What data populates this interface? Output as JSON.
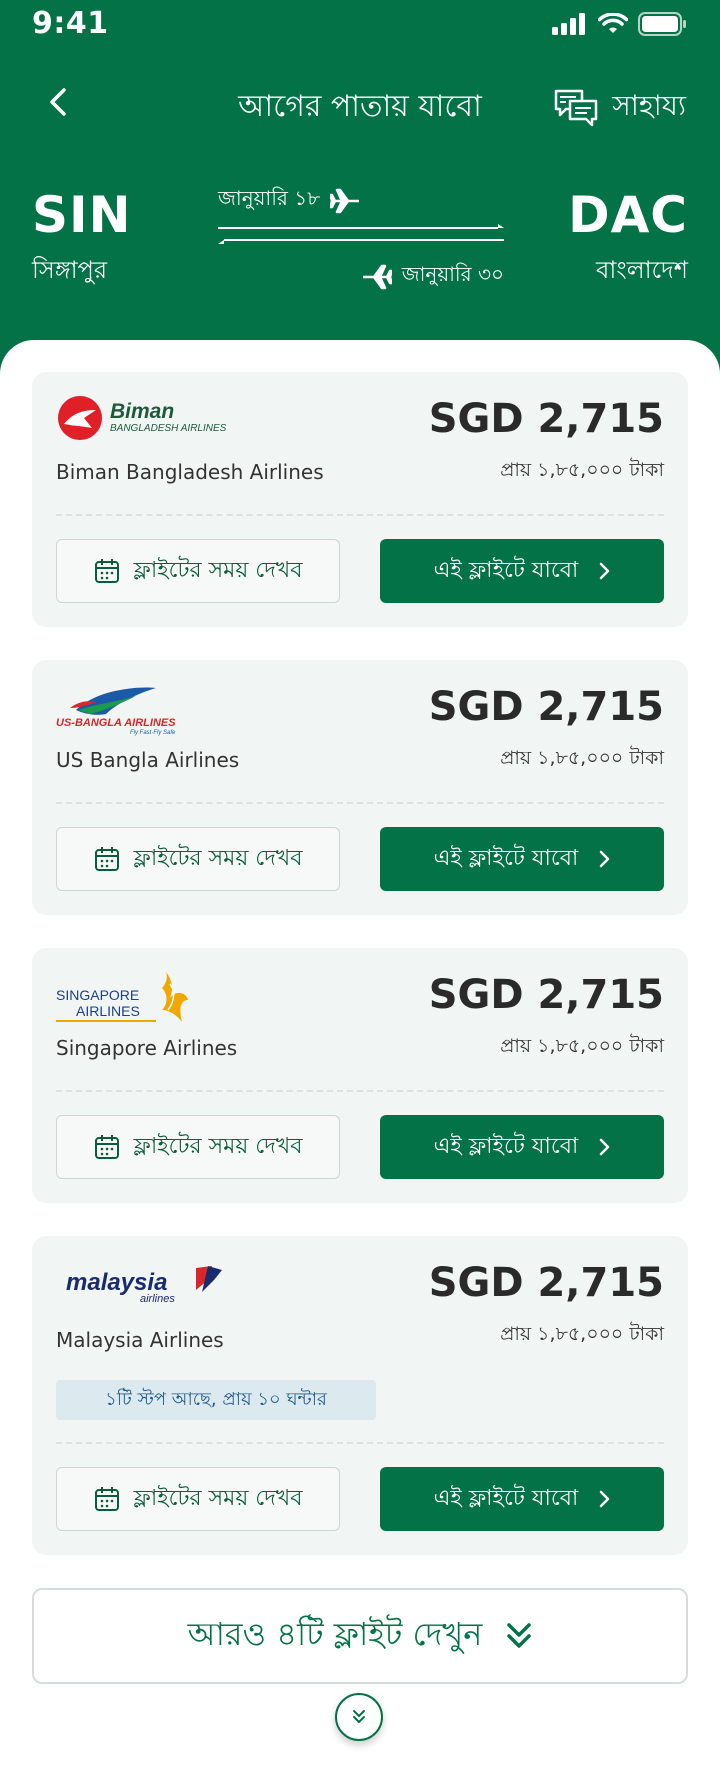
{
  "status": {
    "time": "9:41"
  },
  "nav": {
    "title": "আগের পাতায় যাবো",
    "help_label": "সাহায্য"
  },
  "route": {
    "origin_code": "SIN",
    "origin_name": "সিঙ্গাপুর",
    "dest_code": "DAC",
    "dest_name": "বাংলাদেশ",
    "depart_date": "জানুয়ারি ১৮",
    "return_date": "জানুয়ারি ৩০"
  },
  "cards": [
    {
      "logo_text": "Biman",
      "logo_subtext": "BANGLADESH AIRLINES",
      "name": "Biman Bangladesh Airlines",
      "price": "SGD 2,715",
      "approx": "প্রায় ১,৮৫,০০০ টাকা",
      "schedule_label": "ফ্লাইটের সময় দেখব",
      "go_label": "এই ফ্লাইটে যাবো"
    },
    {
      "logo_text": "US-BANGLA AIRLINES",
      "logo_subtext": "Fly Fast·Fly Safe",
      "name": "US Bangla Airlines",
      "price": "SGD 2,715",
      "approx": "প্রায় ১,৮৫,০০০ টাকা",
      "schedule_label": "ফ্লাইটের সময় দেখব",
      "go_label": "এই ফ্লাইটে যাবো"
    },
    {
      "logo_text": "SINGAPORE",
      "logo_subtext": "AIRLINES",
      "name": "Singapore Airlines",
      "price": "SGD 2,715",
      "approx": "প্রায় ১,৮৫,০০০ টাকা",
      "schedule_label": "ফ্লাইটের সময় দেখব",
      "go_label": "এই ফ্লাইটে যাবো"
    },
    {
      "logo_text": "malaysia",
      "logo_subtext": "airlines",
      "name": "Malaysia Airlines",
      "price": "SGD 2,715",
      "approx": "প্রায় ১,৮৫,০০০ টাকা",
      "stop_info": "১টি স্টপ আছে, প্রায় ১০ ঘন্টার",
      "schedule_label": "ফ্লাইটের সময় দেখব",
      "go_label": "এই ফ্লাইটে যাবো"
    }
  ],
  "more_label": "আরও ৪টি ফ্লাইট দেখুন",
  "colors": {
    "primary": "#047247",
    "card_bg": "#f1f6f4",
    "badge_bg": "#dce9ee"
  },
  "icons": [
    "back-chevron-icon",
    "chat-icon",
    "plane-icon",
    "calendar-icon",
    "chevron-right-icon",
    "double-chevron-down-icon"
  ]
}
